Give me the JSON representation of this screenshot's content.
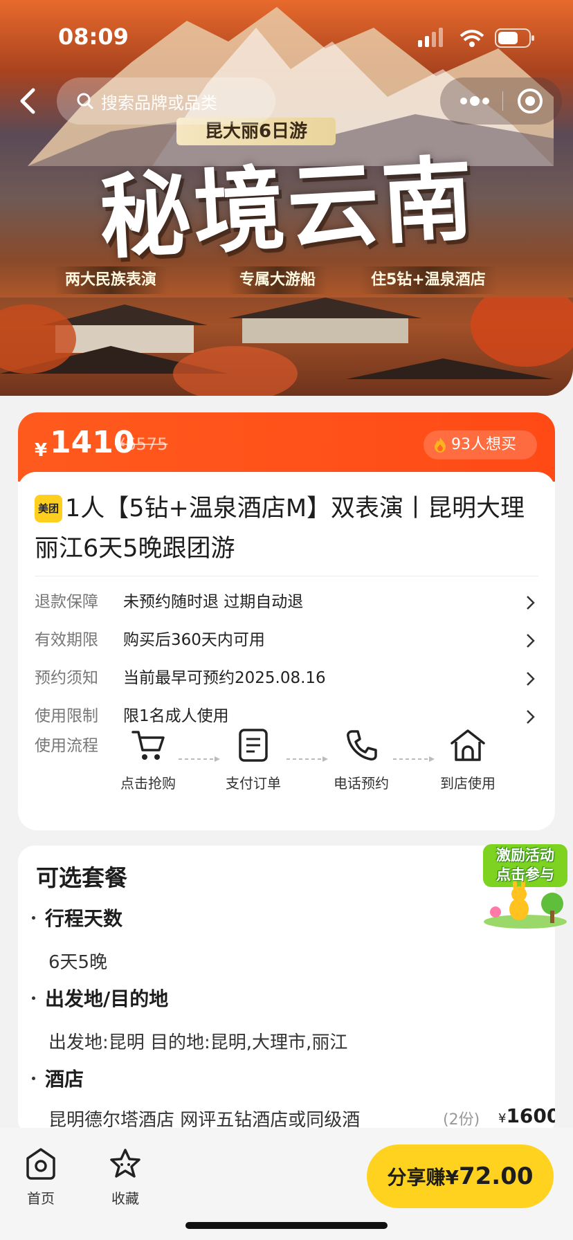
{
  "status_bar": {
    "time": "08:09"
  },
  "search": {
    "placeholder": "搜索品牌或品类"
  },
  "banner": {
    "subtitle": "昆大丽6日游",
    "title": "秘境云南",
    "taglines": [
      "两大民族表演",
      "专属大游船",
      "住5钻+温泉酒店"
    ]
  },
  "price": {
    "currency": "¥",
    "current": "1410",
    "original": "¥6575",
    "want_count": "93人想买"
  },
  "product": {
    "brand_badge": "美团",
    "title": "1人【5钻+温泉酒店M】双表演丨昆明大理丽江6天5晚跟团游"
  },
  "info_rows": [
    {
      "key": "退款保障",
      "value": "未预约随时退 过期自动退"
    },
    {
      "key": "有效期限",
      "value": "购买后360天内可用"
    },
    {
      "key": "预约须知",
      "value": "当前最早可预约2025.08.16"
    },
    {
      "key": "使用限制",
      "value": "限1名成人使用"
    }
  ],
  "flow": {
    "label": "使用流程",
    "steps": [
      "点击抢购",
      "支付订单",
      "电话预约",
      "到店使用"
    ]
  },
  "options": {
    "title": "可选套餐",
    "sections": [
      {
        "heading": "行程天数",
        "value": "6天5晚"
      },
      {
        "heading": "出发地/目的地",
        "value": "出发地:昆明 目的地:昆明,大理市,丽江"
      },
      {
        "heading": "酒店",
        "value": ""
      }
    ],
    "hotel": {
      "name": "昆明德尔塔酒店 网评五钻酒店或同级酒",
      "qty": "(2份)",
      "currency": "¥",
      "price": "1600"
    }
  },
  "promo": {
    "line1": "激励活动",
    "line2": "点击参与"
  },
  "bottom_nav": {
    "home": "首页",
    "favorite": "收藏",
    "share_label": "分享赚",
    "share_currency": "¥",
    "share_amount": "72.00"
  },
  "colors": {
    "accent": "#ff4a16",
    "share_button": "#ffd21f",
    "brand": "#ffcf1f"
  }
}
